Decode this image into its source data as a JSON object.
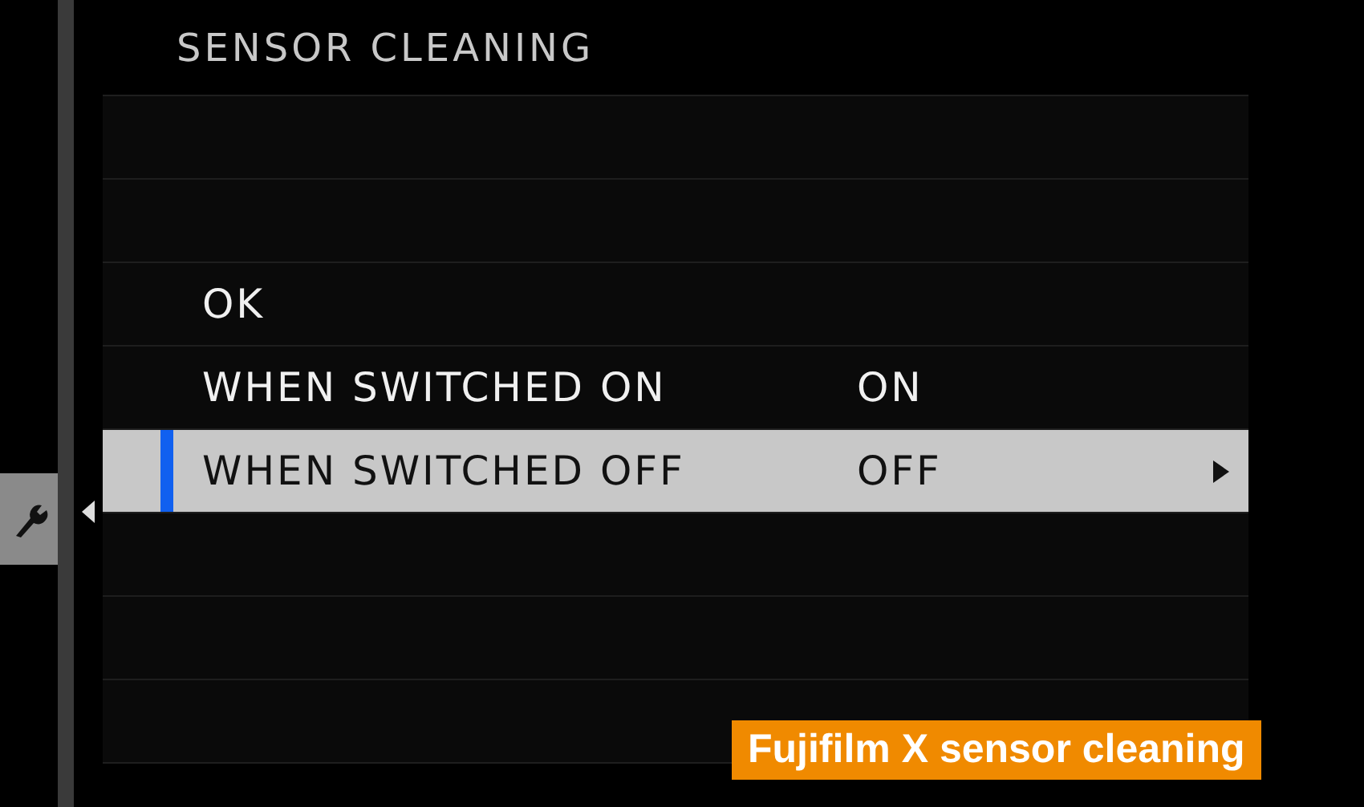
{
  "title": "SENSOR CLEANING",
  "side_tab": {
    "selected": true
  },
  "items": [
    {
      "label": "OK",
      "value": "",
      "selected": false
    },
    {
      "label": "WHEN SWITCHED ON",
      "value": "ON",
      "selected": false
    },
    {
      "label": "WHEN SWITCHED OFF",
      "value": "OFF",
      "selected": true
    }
  ],
  "caption": "Fujifilm X sensor cleaning"
}
